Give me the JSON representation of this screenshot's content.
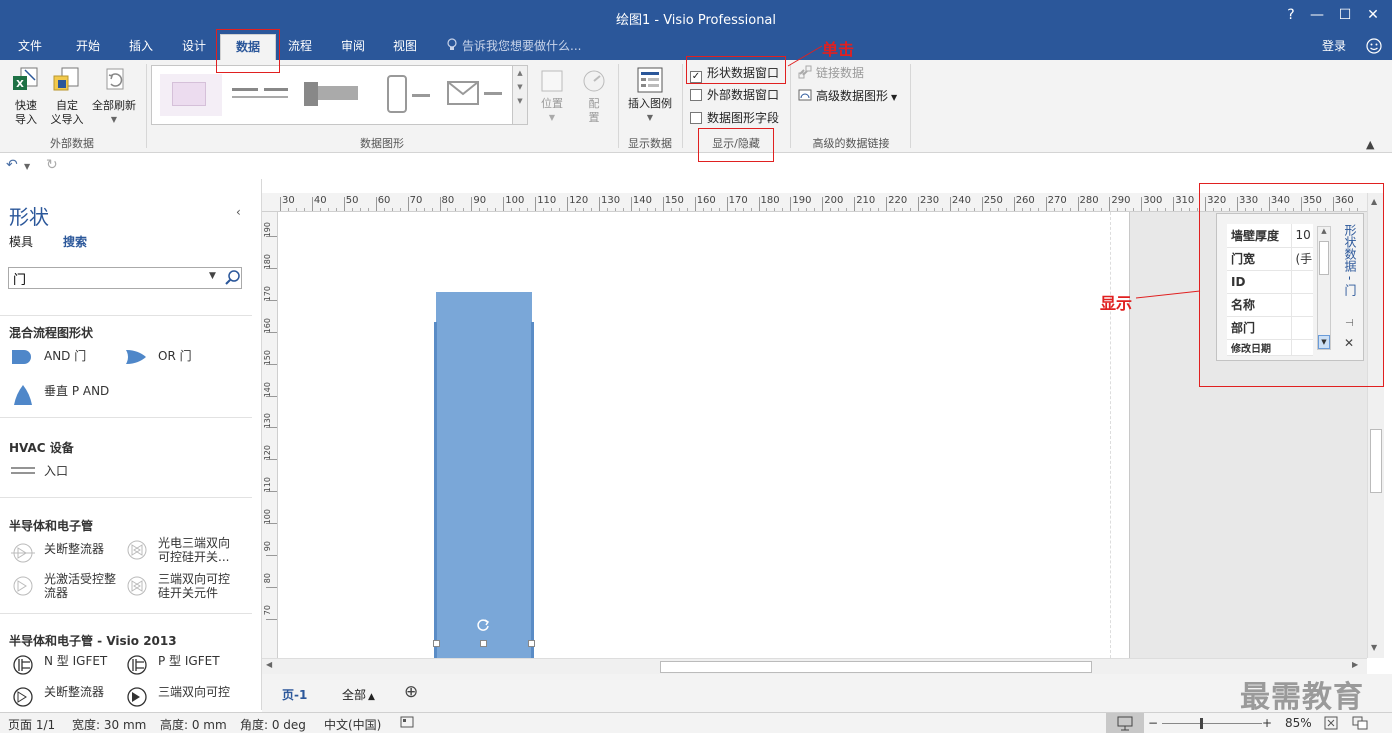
{
  "window": {
    "title": "绘图1 - Visio Professional",
    "help": "?",
    "minimize": "—",
    "maximize": "☐",
    "close": "✕"
  },
  "tabs": [
    "文件",
    "开始",
    "插入",
    "设计",
    "数据",
    "流程",
    "审阅",
    "视图"
  ],
  "active_tab": "数据",
  "tell_me": "告诉我您想要做什么...",
  "login": "登录",
  "ribbon": {
    "external_data": {
      "label": "外部数据",
      "quick_import": "快速\n导入",
      "custom_import": "自定\n义导入",
      "refresh_all": "全部刷新"
    },
    "data_graphics": {
      "label": "数据图形",
      "position": "位置",
      "configure": "配\n置"
    },
    "display_data": {
      "label": "显示数据",
      "insert_legend": "插入图例"
    },
    "show_hide": {
      "label": "显示/隐藏",
      "shape_data_window": "形状数据窗口",
      "external_data_window": "外部数据窗口",
      "data_graphic_fields": "数据图形字段"
    },
    "advanced_links": {
      "label": "高级的数据链接",
      "link_data": "链接数据",
      "advanced_graphics": "高级数据图形"
    }
  },
  "shapes_panel": {
    "title": "形状",
    "tab_stencils": "模具",
    "tab_search": "搜索",
    "search_value": "门",
    "categories": [
      {
        "name": "混合流程图形状",
        "items": [
          "AND 门",
          "OR 门",
          "垂直 P AND"
        ]
      },
      {
        "name": "HVAC 设备",
        "items": [
          "入口"
        ]
      },
      {
        "name": "半导体和电子管",
        "items": [
          "关断整流器",
          "光电三端双向\n可控硅开关...",
          "光激活受控整\n流器",
          "三端双向可控\n硅开关元件"
        ]
      },
      {
        "name": "半导体和电子管 - Visio 2013",
        "items": [
          "N 型 IGFET",
          "P 型 IGFET",
          "关断整流器",
          "三端双向可控"
        ]
      }
    ]
  },
  "ruler": {
    "h": [
      "30",
      "40",
      "50",
      "60",
      "70",
      "80",
      "90",
      "100",
      "110",
      "120",
      "130",
      "140",
      "150",
      "160",
      "170",
      "180",
      "190",
      "200",
      "210",
      "220",
      "230",
      "240",
      "250",
      "260",
      "270",
      "280",
      "290",
      "300",
      "310",
      "320",
      "330",
      "340",
      "350",
      "360"
    ],
    "v": [
      "190",
      "180",
      "170",
      "160",
      "150",
      "140",
      "130",
      "120",
      "110",
      "100",
      "90",
      "80",
      "70"
    ]
  },
  "shape_data": {
    "title": "形状数据 - 门",
    "rows": [
      {
        "key": "墙壁厚度",
        "value": "10"
      },
      {
        "key": "门宽",
        "value": "(手"
      },
      {
        "key": "ID",
        "value": ""
      },
      {
        "key": "名称",
        "value": ""
      },
      {
        "key": "部门",
        "value": ""
      },
      {
        "key": "修改日期",
        "value": ""
      }
    ]
  },
  "annotations": {
    "click": "单击",
    "display": "显示"
  },
  "page_tabs": {
    "page": "页-1",
    "all": "全部",
    "all_arrow": "▲",
    "add": "⊕"
  },
  "status": {
    "page": "页面 1/1",
    "width": "宽度: 30 mm",
    "height": "高度: 0 mm",
    "angle": "角度: 0 deg",
    "lang": "中文(中国)",
    "zoom": "85%"
  },
  "watermark": "最需教育",
  "colors": {
    "brand": "#2b579a",
    "shape_fill": "#7aa7d8",
    "annotation": "#e02020"
  }
}
